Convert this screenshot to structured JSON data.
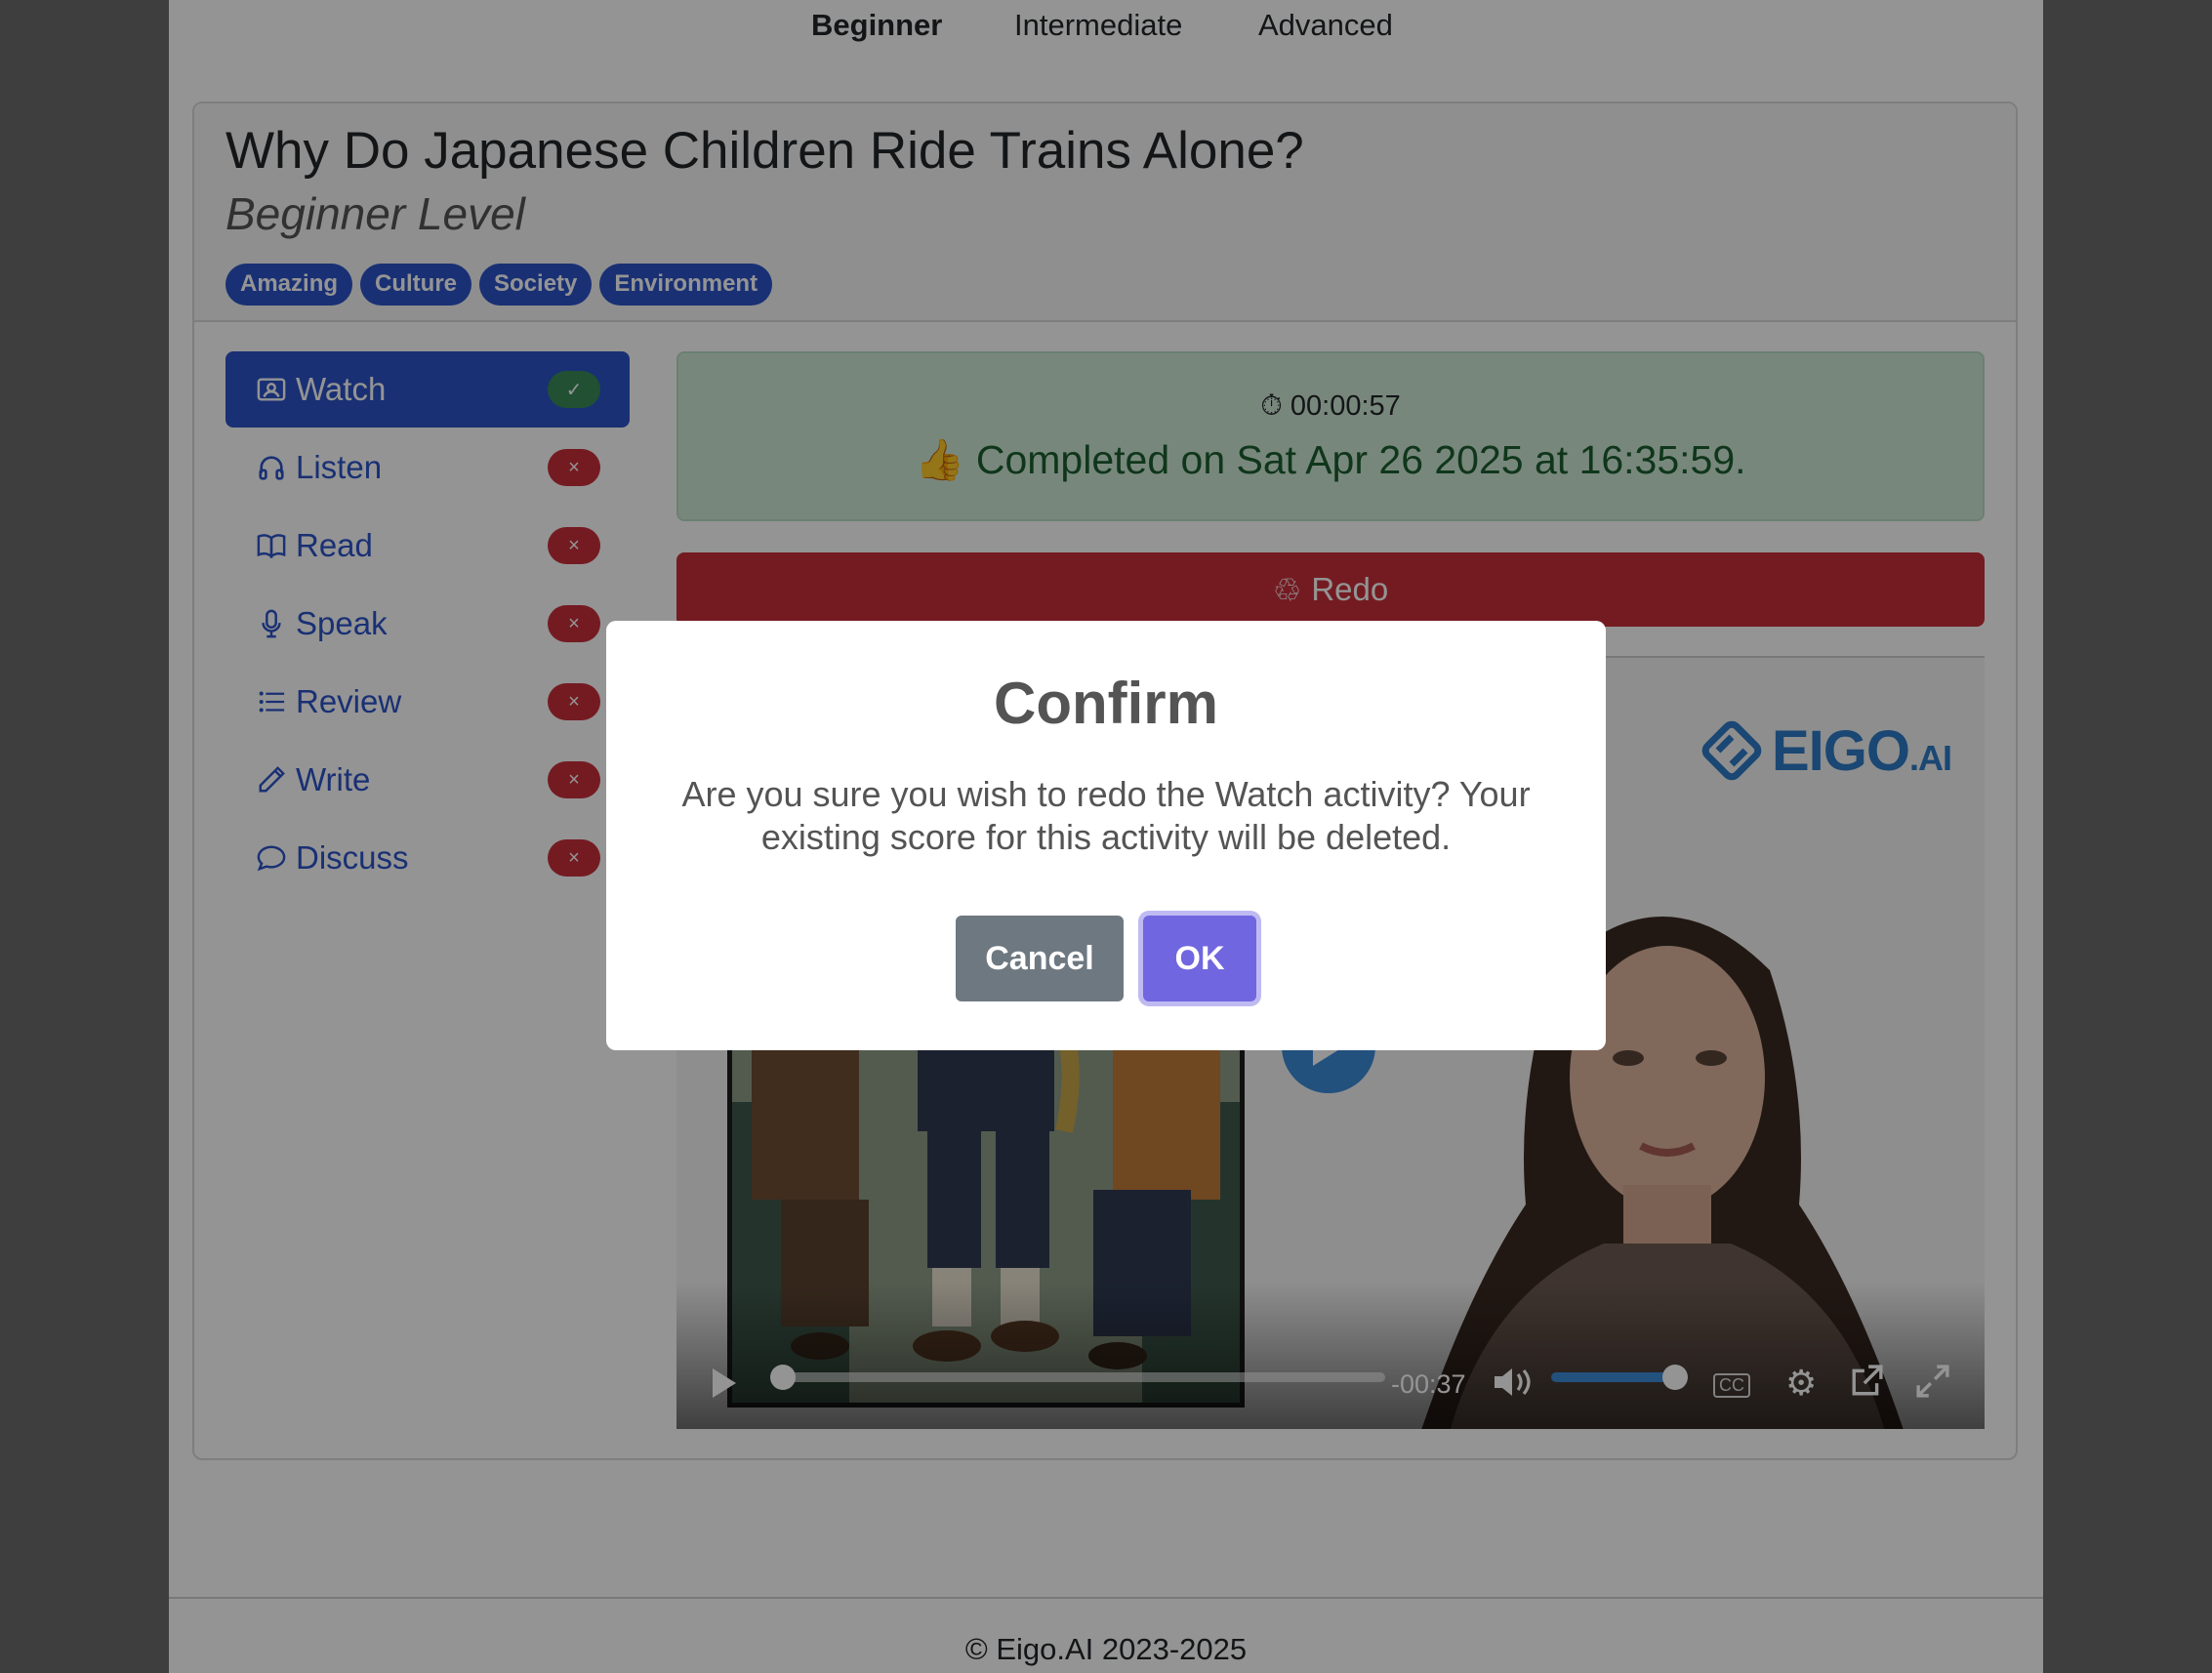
{
  "levels": [
    "Beginner",
    "Intermediate",
    "Advanced"
  ],
  "lesson": {
    "title": "Why Do Japanese Children Ride Trains Alone?",
    "level": "Beginner Level",
    "tags": [
      "Amazing",
      "Culture",
      "Society",
      "Environment"
    ]
  },
  "sidebar": {
    "items": [
      {
        "label": "Watch",
        "icon": "watch-icon",
        "status": "done"
      },
      {
        "label": "Listen",
        "icon": "headphones-icon",
        "status": "todo"
      },
      {
        "label": "Read",
        "icon": "book-icon",
        "status": "todo"
      },
      {
        "label": "Speak",
        "icon": "microphone-icon",
        "status": "todo"
      },
      {
        "label": "Review",
        "icon": "list-icon",
        "status": "todo"
      },
      {
        "label": "Write",
        "icon": "pencil-icon",
        "status": "todo"
      },
      {
        "label": "Discuss",
        "icon": "chat-icon",
        "status": "todo"
      }
    ],
    "done_glyph": "✓",
    "todo_glyph": "×"
  },
  "status": {
    "timer": "00:00:57",
    "completed_text": "👍 Completed on Sat Apr 26 2025 at 16:35:59."
  },
  "redo_label": "Redo",
  "player": {
    "logo_text": "EIGO",
    "logo_suffix": ".AI",
    "time_remaining": "-00:37",
    "cc_label": "CC",
    "progress": 0.0,
    "volume": 0.9
  },
  "footer": "© Eigo.AI 2023-2025",
  "modal": {
    "title": "Confirm",
    "message": "Are you sure you wish to redo the Watch activity? Your existing score for this activity will be deleted.",
    "cancel_label": "Cancel",
    "ok_label": "OK"
  },
  "colors": {
    "primary": "#2b54c9",
    "danger": "#c9303c",
    "success": "#3a8a58",
    "modal_ok": "#7066e0",
    "modal_cancel": "#6e7881"
  }
}
